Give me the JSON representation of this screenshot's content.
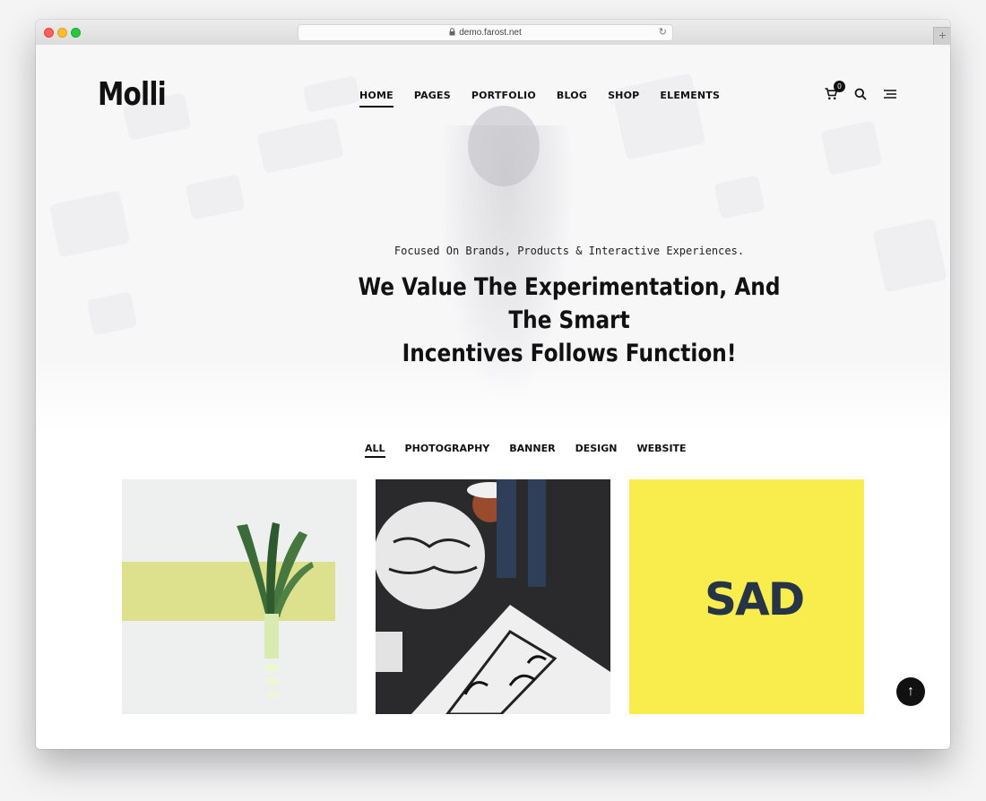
{
  "browser": {
    "url": "demo.farost.net",
    "new_tab_symbol": "+"
  },
  "header": {
    "logo": "Molli",
    "nav": [
      {
        "label": "HOME",
        "active": true
      },
      {
        "label": "PAGES",
        "active": false
      },
      {
        "label": "PORTFOLIO",
        "active": false
      },
      {
        "label": "BLOG",
        "active": false
      },
      {
        "label": "SHOP",
        "active": false
      },
      {
        "label": "ELEMENTS",
        "active": false
      }
    ],
    "cart_count": "0",
    "icons": [
      "cart-icon",
      "search-icon",
      "menu-icon"
    ]
  },
  "hero": {
    "tagline": "Focused On Brands, Products & Interactive Experiences.",
    "headline_line1": "We Value The Experimentation, And The Smart",
    "headline_line2": "Incentives Follows Function!"
  },
  "portfolio": {
    "filters": [
      {
        "label": "ALL",
        "active": true
      },
      {
        "label": "PHOTOGRAPHY",
        "active": false
      },
      {
        "label": "BANNER",
        "active": false
      },
      {
        "label": "DESIGN",
        "active": false
      },
      {
        "label": "WEBSITE",
        "active": false
      }
    ],
    "items": [
      {
        "name": "leek-photo"
      },
      {
        "name": "street-artist-photo"
      },
      {
        "name": "sad-logo-design",
        "text": "SAD"
      }
    ]
  },
  "scroll_top_icon": "arrow-up-icon",
  "colors": {
    "accent": "#111111",
    "yellow": "#f9ed4e",
    "stripe": "#dcdf88"
  }
}
